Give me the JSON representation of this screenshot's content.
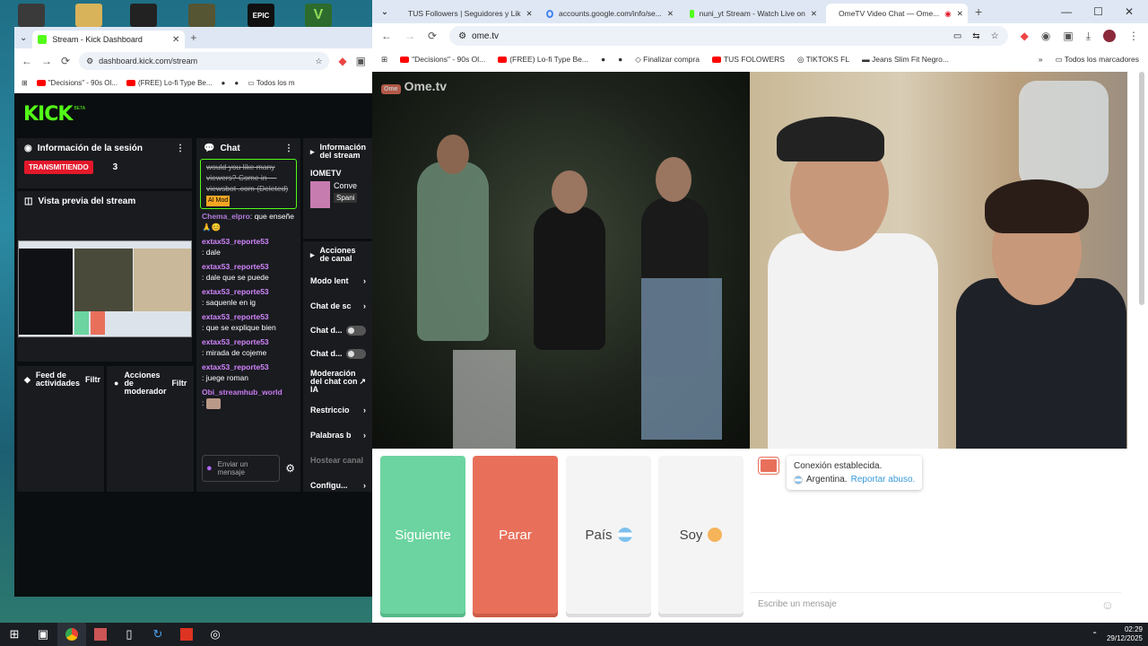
{
  "left_browser": {
    "tab_title": "Stream - Kick Dashboard",
    "url": "dashboard.kick.com/stream",
    "bookmarks": [
      "\"Decisions\" - 90s Ol...",
      "(FREE) Lo-fi Type Be...",
      "Todos los m"
    ],
    "logo": "KICK",
    "logo_sup": "BETA",
    "session": {
      "title": "Información de la sesión",
      "live_badge": "TRANSMITIENDO",
      "viewers": "3"
    },
    "preview_title": "Vista previa del stream",
    "activity_title": "Feed de actividades",
    "activity_filter": "Filtr",
    "mod_actions_title": "Acciones de moderador",
    "mod_filter": "Filtr",
    "chat": {
      "title": "Chat",
      "messages": [
        {
          "user": "",
          "text": "would you like many viewers? Come in — viewsbot .com (Deleted)",
          "tag": "AI Mod"
        },
        {
          "user": "Chema_elpro",
          "text": ": que enseñe 🙏😊"
        },
        {
          "user": "extax53_reporte53",
          "text": ": dale"
        },
        {
          "user": "extax53_reporte53",
          "text": ": dale que se puede"
        },
        {
          "user": "extax53_reporte53",
          "text": ": saquenle en ig"
        },
        {
          "user": "extax53_reporte53",
          "text": ": que se explique bien"
        },
        {
          "user": "extax53_reporte53",
          "text": ": mirada de cojeme"
        },
        {
          "user": "extax53_reporte53",
          "text": ": juege roman"
        },
        {
          "user": "Obi_streamhub_world",
          "text": ":"
        }
      ],
      "send_placeholder": "Enviar un mensaje"
    },
    "stream_info": {
      "title": "Información del stream",
      "channel": "IOMETV",
      "category": "Conve",
      "language": "Spani"
    },
    "channel_actions": {
      "title": "Acciones de canal",
      "items": [
        "Modo lent",
        "Chat de sc",
        "Chat d...",
        "Chat d...",
        "Moderación del chat con IA",
        "Restriccio",
        "Palabras b",
        "Hostear canal",
        "Configu..."
      ]
    }
  },
  "right_browser": {
    "tabs": [
      "TUS Followers | Seguidores y Lik",
      "accounts.google.com/info/se...",
      "nuni_yt Stream - Watch Live on",
      "OmeTV Video Chat — Ome..."
    ],
    "url": "ome.tv",
    "bookmarks": [
      "\"Decisions\" - 90s Ol...",
      "(FREE) Lo-fi Type Be...",
      "Finalizar compra",
      "TUS FOLOWERS",
      "TIKTOKS FL",
      "Jeans Slim Fit Negro...",
      "Todos los marcadores"
    ],
    "logo": "Ome.tv",
    "buttons": {
      "next": "Siguiente",
      "stop": "Parar",
      "country": "País",
      "gender": "Soy"
    },
    "messages": {
      "line1": "Conexión establecida.",
      "line2": "Argentina.",
      "report": "Reportar abuso."
    },
    "chat_placeholder": "Escribe un mensaje"
  },
  "taskbar": {
    "time": "02:29",
    "date": "29/12/2025"
  },
  "colors": {
    "kick_green": "#53fc18",
    "live_red": "#e3182b",
    "next_green": "#6cd4a0",
    "stop_red": "#e8705b"
  }
}
